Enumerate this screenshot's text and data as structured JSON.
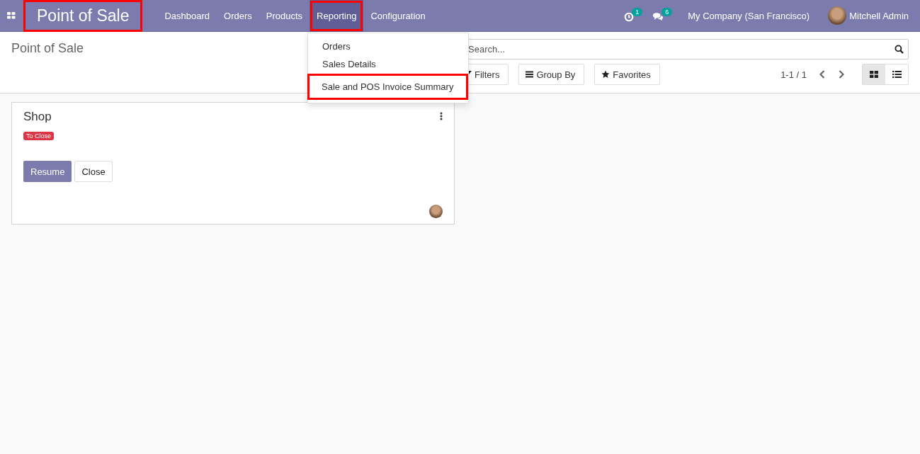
{
  "navbar": {
    "app_name": "Point of Sale",
    "app_name_highlighted": true,
    "menu": [
      {
        "label": "Dashboard",
        "selected": false,
        "highlighted": false
      },
      {
        "label": "Orders",
        "selected": false,
        "highlighted": false
      },
      {
        "label": "Products",
        "selected": false,
        "highlighted": false
      },
      {
        "label": "Reporting",
        "selected": true,
        "highlighted": true
      },
      {
        "label": "Configuration",
        "selected": false,
        "highlighted": false
      }
    ],
    "activity_count": "1",
    "message_count": "6",
    "company": "My Company (San Francisco)",
    "user": "Mitchell Admin"
  },
  "dropdown": {
    "items": [
      {
        "label": "Orders",
        "highlighted": false
      },
      {
        "label": "Sales Details",
        "highlighted": false
      },
      {
        "label": "Sale and POS Invoice Summary",
        "highlighted": true
      }
    ]
  },
  "control_panel": {
    "breadcrumb": "Point of Sale",
    "search": {
      "placeholder": "Search..."
    },
    "buttons": [
      "Filters",
      "Group By",
      "Favorites"
    ],
    "pager": "1-1 / 1",
    "views": [
      {
        "kind": "kanban",
        "selected": true
      },
      {
        "kind": "list",
        "selected": false
      }
    ]
  },
  "cards": [
    {
      "title": "Shop",
      "tag": "To Close",
      "buttons": [
        {
          "label": "Resume",
          "kind": "primary"
        },
        {
          "label": "Close",
          "kind": "secondary"
        }
      ]
    }
  ]
}
